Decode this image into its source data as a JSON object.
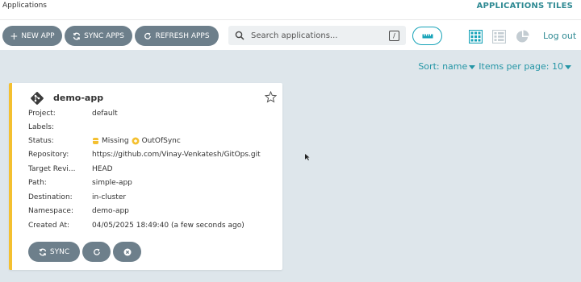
{
  "header": {
    "title": "Applications",
    "view_title": "APPLICATIONS TILES",
    "logout_label": "Log out"
  },
  "toolbar": {
    "new_app": "NEW APP",
    "sync_apps": "SYNC APPS",
    "refresh_apps": "REFRESH APPS"
  },
  "search": {
    "placeholder": "Search applications...",
    "shortcut": "/"
  },
  "sort": {
    "label": "Sort: name",
    "items_per_page": "Items per page: 10"
  },
  "app": {
    "name": "demo-app",
    "fields": [
      {
        "label": "Project:",
        "value": "default"
      },
      {
        "label": "Labels:",
        "value": ""
      },
      {
        "label": "Status:",
        "value": ""
      },
      {
        "label": "Repository:",
        "value": "https://github.com/Vinay-Venkatesh/GitOps.git"
      },
      {
        "label": "Target Revi...",
        "value": "HEAD"
      },
      {
        "label": "Path:",
        "value": "simple-app"
      },
      {
        "label": "Destination:",
        "value": "in-cluster"
      },
      {
        "label": "Namespace:",
        "value": "demo-app"
      },
      {
        "label": "Created At:",
        "value": "04/05/2025 18:49:40  (a few seconds ago)"
      }
    ],
    "health_status": "Missing",
    "sync_status": "OutOfSync",
    "sync_button": "SYNC"
  },
  "colors": {
    "accent": "#2f8a93",
    "button": "#6d7f8b",
    "card_border": "#f4c030",
    "missing": "#f4c030",
    "outofsync": "#f4c030"
  },
  "icons": {
    "new_app": "plus-icon",
    "sync": "sync-icon",
    "refresh": "refresh-icon",
    "search": "search-icon",
    "filter": "filter-ruler-icon",
    "tiles": "tiles-view-icon",
    "list": "list-view-icon",
    "summary": "pie-chart-icon",
    "app_logo": "git-icon",
    "favorite": "star-icon",
    "delete": "delete-icon"
  }
}
